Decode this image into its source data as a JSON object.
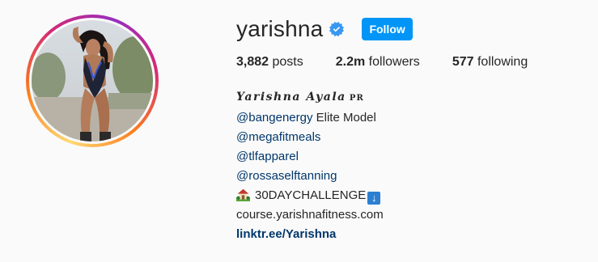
{
  "profile": {
    "username": "yarishna",
    "verified": true,
    "follow_label": "Follow",
    "accent_color": "#0095f6"
  },
  "stats": {
    "posts_count": "3,882",
    "posts_label": "posts",
    "followers_count": "2.2m",
    "followers_label": "followers",
    "following_count": "577",
    "following_label": "following"
  },
  "bio": {
    "full_name": "Yarishna Ayala",
    "full_name_suffix": "PR",
    "line1_mention": "@bangenergy",
    "line1_text": " Elite Model",
    "mention2": "@megafitmeals",
    "mention3": "@tlfapparel",
    "mention4": "@rossaselftanning",
    "challenge_icon": "house-with-garden-emoji",
    "challenge_text": "30DAYCHALLENGE",
    "challenge_arrow": "down-arrow-emoji",
    "course_text": "course.yarishnafitness.com",
    "link_text": "linktr.ee/Yarishna"
  }
}
